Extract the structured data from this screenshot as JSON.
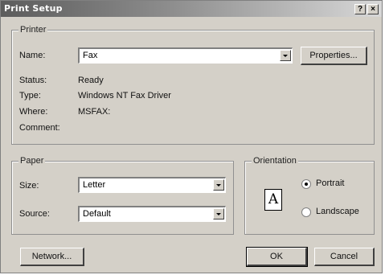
{
  "window": {
    "title": "Print Setup",
    "help_button": "?",
    "close_button": "×"
  },
  "printer": {
    "group_label": "Printer",
    "name_label": "Name:",
    "name_value": "Fax",
    "properties_button": "Properties...",
    "status_label": "Status:",
    "status_value": "Ready",
    "type_label": "Type:",
    "type_value": "Windows NT Fax Driver",
    "where_label": "Where:",
    "where_value": "MSFAX:",
    "comment_label": "Comment:",
    "comment_value": ""
  },
  "paper": {
    "group_label": "Paper",
    "size_label": "Size:",
    "size_value": "Letter",
    "source_label": "Source:",
    "source_value": "Default"
  },
  "orientation": {
    "group_label": "Orientation",
    "icon_letter": "A",
    "portrait_label": "Portrait",
    "landscape_label": "Landscape",
    "selected": "portrait"
  },
  "buttons": {
    "network": "Network...",
    "ok": "OK",
    "cancel": "Cancel"
  }
}
